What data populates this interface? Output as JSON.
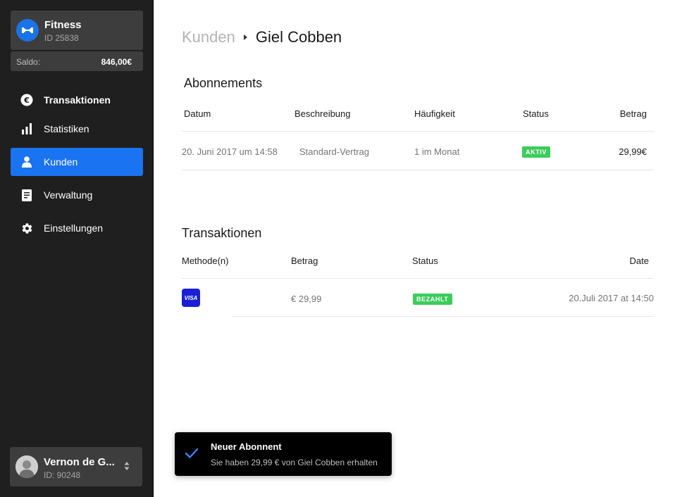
{
  "brand": {
    "name": "Fitness",
    "id": "ID 25838"
  },
  "saldo": {
    "label": "Saldo:",
    "value": "846,00€"
  },
  "nav": [
    {
      "label": "Transaktionen",
      "icon": "euro-icon"
    },
    {
      "label": "Statistiken",
      "icon": "bar-chart-icon"
    },
    {
      "label": "Kunden",
      "icon": "person-icon",
      "active": true
    },
    {
      "label": "Verwaltung",
      "icon": "document-icon"
    },
    {
      "label": "Einstellungen",
      "icon": "gear-icon"
    }
  ],
  "user": {
    "name": "Vernon de G...",
    "id": "ID: 90248"
  },
  "breadcrumb": {
    "parent": "Kunden",
    "current": "Giel Cobben"
  },
  "subscriptions": {
    "title": "Abonnements",
    "headers": {
      "date": "Datum",
      "description": "Beschreibung",
      "frequency": "Häufigkeit",
      "status": "Status",
      "amount": "Betrag"
    },
    "rows": [
      {
        "date": "20. Juni 2017 um 14:58",
        "description": "Standard-Vertrag",
        "frequency": "1 im Monat",
        "status": "AKTIV",
        "amount": "29,99€"
      }
    ]
  },
  "transactions": {
    "title": "Transaktionen",
    "headers": {
      "method": "Methode(n)",
      "amount": "Betrag",
      "status": "Status",
      "date": "Date"
    },
    "rows": [
      {
        "method": "VISA",
        "amount": "€ 29,99",
        "status": "BEZAHLT",
        "date": "20.Juli 2017 at 14:50"
      }
    ]
  },
  "toast": {
    "title": "Neuer Abonnent",
    "message": "Sie haben 29,99 € von Giel Cobben erhalten"
  },
  "colors": {
    "accent": "#1a73f0",
    "success": "#3bcc5a",
    "sidebar": "#1f1f1f",
    "visa": "#1a1fd6"
  }
}
